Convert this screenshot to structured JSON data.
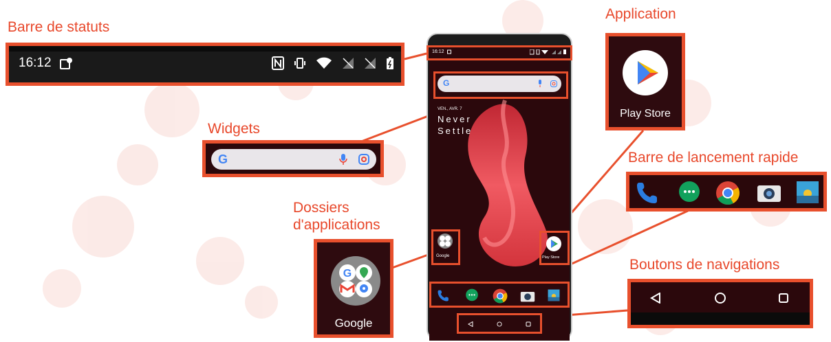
{
  "labels": {
    "status_bar": "Barre de statuts",
    "application": "Application",
    "widgets": "Widgets",
    "quick_launch": "Barre de lancement rapide",
    "app_folders_line1": "Dossiers",
    "app_folders_line2": "d'applications",
    "nav_buttons": "Boutons de navigations"
  },
  "status_bar": {
    "time": "16:12"
  },
  "phone": {
    "time": "16:12",
    "date": "VEN., AVR. 7",
    "wallpaper_line1": "Never",
    "wallpaper_line2": "Settle",
    "folder_label": "Google",
    "app_label": "Play Store"
  },
  "application_callout": {
    "app_name": "Play Store"
  },
  "folder_callout": {
    "folder_name": "Google"
  },
  "dock_apps": [
    "phone-icon",
    "messages-icon",
    "chrome-icon",
    "camera-icon",
    "gallery-icon"
  ],
  "nav_icons": [
    "back-icon",
    "home-icon",
    "recents-icon"
  ],
  "colors": {
    "accent": "#e8502d",
    "screen_bg": "#2b080c",
    "label": "#e8482b"
  }
}
